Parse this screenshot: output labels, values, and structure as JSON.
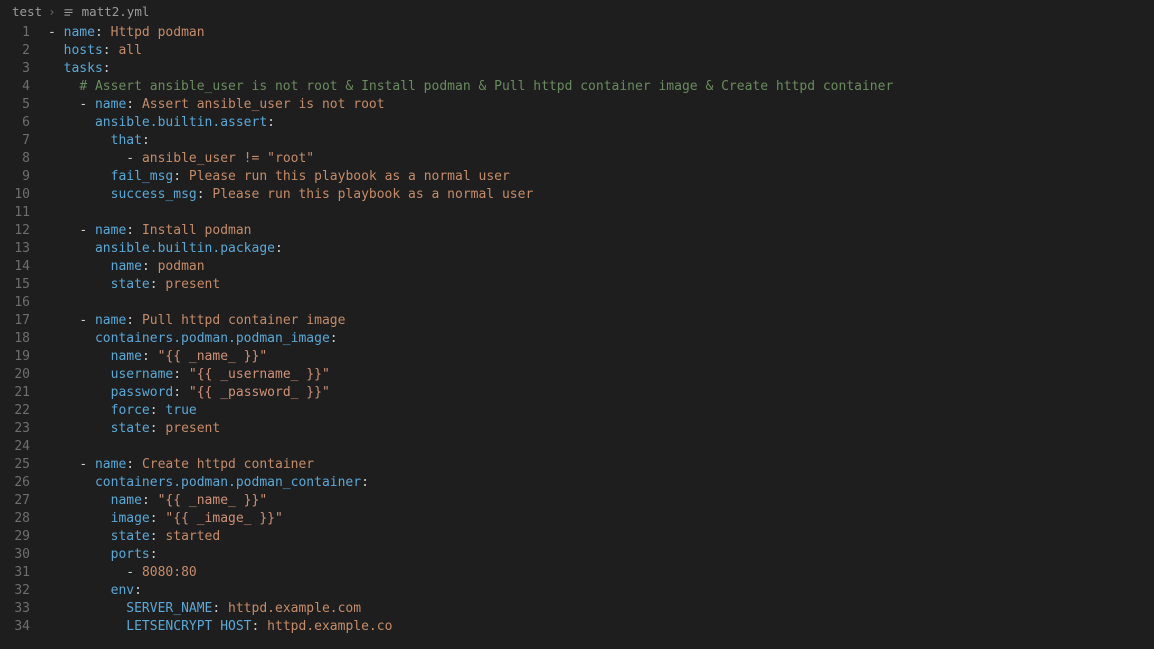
{
  "breadcrumb": {
    "folder": "test",
    "file": "matt2.yml"
  },
  "lines": [
    {
      "num": "1",
      "indent": 0,
      "guides": [],
      "tokens": [
        {
          "c": "tok-dash",
          "t": "- "
        },
        {
          "c": "tok-key",
          "t": "name"
        },
        {
          "c": "tok-colon",
          "t": ": "
        },
        {
          "c": "tok-plain",
          "t": "Httpd podman"
        }
      ]
    },
    {
      "num": "2",
      "indent": 1,
      "guides": [
        0
      ],
      "tokens": [
        {
          "c": "tok-key",
          "t": "hosts"
        },
        {
          "c": "tok-colon",
          "t": ": "
        },
        {
          "c": "tok-plain",
          "t": "all"
        }
      ]
    },
    {
      "num": "3",
      "indent": 1,
      "guides": [
        0
      ],
      "tokens": [
        {
          "c": "tok-key",
          "t": "tasks"
        },
        {
          "c": "tok-colon",
          "t": ":"
        }
      ]
    },
    {
      "num": "4",
      "indent": 2,
      "guides": [
        0,
        1
      ],
      "tokens": [
        {
          "c": "tok-comment",
          "t": "# Assert ansible_user is not root & Install podman & Pull httpd container image & Create httpd container"
        }
      ]
    },
    {
      "num": "5",
      "indent": 2,
      "guides": [
        0,
        1
      ],
      "tokens": [
        {
          "c": "tok-dash",
          "t": "- "
        },
        {
          "c": "tok-key",
          "t": "name"
        },
        {
          "c": "tok-colon",
          "t": ": "
        },
        {
          "c": "tok-plain",
          "t": "Assert ansible_user is not root"
        }
      ]
    },
    {
      "num": "6",
      "indent": 3,
      "guides": [
        0,
        1,
        2
      ],
      "tokens": [
        {
          "c": "tok-key",
          "t": "ansible.builtin.assert"
        },
        {
          "c": "tok-colon",
          "t": ":"
        }
      ]
    },
    {
      "num": "7",
      "indent": 4,
      "guides": [
        0,
        1,
        2,
        3
      ],
      "tokens": [
        {
          "c": "tok-key",
          "t": "that"
        },
        {
          "c": "tok-colon",
          "t": ":"
        }
      ]
    },
    {
      "num": "8",
      "indent": 5,
      "guides": [
        0,
        1,
        2,
        3,
        4
      ],
      "tokens": [
        {
          "c": "tok-dash",
          "t": "- "
        },
        {
          "c": "tok-plain",
          "t": "ansible_user != \"root\""
        }
      ]
    },
    {
      "num": "9",
      "indent": 4,
      "guides": [
        0,
        1,
        2,
        3
      ],
      "tokens": [
        {
          "c": "tok-key",
          "t": "fail_msg"
        },
        {
          "c": "tok-colon",
          "t": ": "
        },
        {
          "c": "tok-plain",
          "t": "Please run this playbook as a normal user"
        }
      ]
    },
    {
      "num": "10",
      "indent": 4,
      "guides": [
        0,
        1,
        2,
        3
      ],
      "tokens": [
        {
          "c": "tok-key",
          "t": "success_msg"
        },
        {
          "c": "tok-colon",
          "t": ": "
        },
        {
          "c": "tok-plain",
          "t": "Please run this playbook as a normal user"
        }
      ]
    },
    {
      "num": "11",
      "indent": 0,
      "guides": [],
      "tokens": []
    },
    {
      "num": "12",
      "indent": 2,
      "guides": [
        0,
        1
      ],
      "tokens": [
        {
          "c": "tok-dash",
          "t": "- "
        },
        {
          "c": "tok-key",
          "t": "name"
        },
        {
          "c": "tok-colon",
          "t": ": "
        },
        {
          "c": "tok-plain",
          "t": "Install podman"
        }
      ]
    },
    {
      "num": "13",
      "indent": 3,
      "guides": [
        0,
        1,
        2
      ],
      "tokens": [
        {
          "c": "tok-key",
          "t": "ansible.builtin.package"
        },
        {
          "c": "tok-colon",
          "t": ":"
        }
      ]
    },
    {
      "num": "14",
      "indent": 4,
      "guides": [
        0,
        1,
        2,
        3
      ],
      "tokens": [
        {
          "c": "tok-key",
          "t": "name"
        },
        {
          "c": "tok-colon",
          "t": ": "
        },
        {
          "c": "tok-plain",
          "t": "podman"
        }
      ]
    },
    {
      "num": "15",
      "indent": 4,
      "guides": [
        0,
        1,
        2,
        3
      ],
      "tokens": [
        {
          "c": "tok-key",
          "t": "state"
        },
        {
          "c": "tok-colon",
          "t": ": "
        },
        {
          "c": "tok-plain",
          "t": "present"
        }
      ]
    },
    {
      "num": "16",
      "indent": 0,
      "guides": [],
      "tokens": []
    },
    {
      "num": "17",
      "indent": 2,
      "guides": [
        0,
        1
      ],
      "tokens": [
        {
          "c": "tok-dash",
          "t": "- "
        },
        {
          "c": "tok-key",
          "t": "name"
        },
        {
          "c": "tok-colon",
          "t": ": "
        },
        {
          "c": "tok-plain",
          "t": "Pull httpd container image"
        }
      ]
    },
    {
      "num": "18",
      "indent": 3,
      "guides": [
        0,
        1,
        2
      ],
      "tokens": [
        {
          "c": "tok-key",
          "t": "containers.podman.podman_image"
        },
        {
          "c": "tok-colon",
          "t": ":"
        }
      ]
    },
    {
      "num": "19",
      "indent": 4,
      "guides": [
        0,
        1,
        2,
        3
      ],
      "tokens": [
        {
          "c": "tok-key",
          "t": "name"
        },
        {
          "c": "tok-colon",
          "t": ": "
        },
        {
          "c": "tok-str",
          "t": "\"{{ _name_ }}\""
        }
      ]
    },
    {
      "num": "20",
      "indent": 4,
      "guides": [
        0,
        1,
        2,
        3
      ],
      "tokens": [
        {
          "c": "tok-key",
          "t": "username"
        },
        {
          "c": "tok-colon",
          "t": ": "
        },
        {
          "c": "tok-str",
          "t": "\"{{ _username_ }}\""
        }
      ]
    },
    {
      "num": "21",
      "indent": 4,
      "guides": [
        0,
        1,
        2,
        3
      ],
      "tokens": [
        {
          "c": "tok-key",
          "t": "password"
        },
        {
          "c": "tok-colon",
          "t": ": "
        },
        {
          "c": "tok-str",
          "t": "\"{{ _password_ }}\""
        }
      ]
    },
    {
      "num": "22",
      "indent": 4,
      "guides": [
        0,
        1,
        2,
        3
      ],
      "tokens": [
        {
          "c": "tok-key",
          "t": "force"
        },
        {
          "c": "tok-colon",
          "t": ": "
        },
        {
          "c": "tok-bool",
          "t": "true"
        }
      ]
    },
    {
      "num": "23",
      "indent": 4,
      "guides": [
        0,
        1,
        2,
        3
      ],
      "tokens": [
        {
          "c": "tok-key",
          "t": "state"
        },
        {
          "c": "tok-colon",
          "t": ": "
        },
        {
          "c": "tok-plain",
          "t": "present"
        }
      ]
    },
    {
      "num": "24",
      "indent": 0,
      "guides": [],
      "tokens": []
    },
    {
      "num": "25",
      "indent": 2,
      "guides": [
        0,
        1
      ],
      "tokens": [
        {
          "c": "tok-dash",
          "t": "- "
        },
        {
          "c": "tok-key",
          "t": "name"
        },
        {
          "c": "tok-colon",
          "t": ": "
        },
        {
          "c": "tok-plain",
          "t": "Create httpd container"
        }
      ]
    },
    {
      "num": "26",
      "indent": 3,
      "guides": [
        0,
        1,
        2
      ],
      "tokens": [
        {
          "c": "tok-key",
          "t": "containers.podman.podman_container"
        },
        {
          "c": "tok-colon",
          "t": ":"
        }
      ]
    },
    {
      "num": "27",
      "indent": 4,
      "guides": [
        0,
        1,
        2,
        3
      ],
      "tokens": [
        {
          "c": "tok-key",
          "t": "name"
        },
        {
          "c": "tok-colon",
          "t": ": "
        },
        {
          "c": "tok-str",
          "t": "\"{{ _name_ }}\""
        }
      ]
    },
    {
      "num": "28",
      "indent": 4,
      "guides": [
        0,
        1,
        2,
        3
      ],
      "tokens": [
        {
          "c": "tok-key",
          "t": "image"
        },
        {
          "c": "tok-colon",
          "t": ": "
        },
        {
          "c": "tok-str",
          "t": "\"{{ _image_ }}\""
        }
      ]
    },
    {
      "num": "29",
      "indent": 4,
      "guides": [
        0,
        1,
        2,
        3
      ],
      "tokens": [
        {
          "c": "tok-key",
          "t": "state"
        },
        {
          "c": "tok-colon",
          "t": ": "
        },
        {
          "c": "tok-plain",
          "t": "started"
        }
      ]
    },
    {
      "num": "30",
      "indent": 4,
      "guides": [
        0,
        1,
        2,
        3
      ],
      "tokens": [
        {
          "c": "tok-key",
          "t": "ports"
        },
        {
          "c": "tok-colon",
          "t": ":"
        }
      ]
    },
    {
      "num": "31",
      "indent": 5,
      "guides": [
        0,
        1,
        2,
        3,
        4
      ],
      "tokens": [
        {
          "c": "tok-dash",
          "t": "- "
        },
        {
          "c": "tok-plain",
          "t": "8080:80"
        }
      ]
    },
    {
      "num": "32",
      "indent": 4,
      "guides": [
        0,
        1,
        2,
        3
      ],
      "tokens": [
        {
          "c": "tok-key",
          "t": "env"
        },
        {
          "c": "tok-colon",
          "t": ":"
        }
      ]
    },
    {
      "num": "33",
      "indent": 5,
      "guides": [
        0,
        1,
        2,
        3,
        4
      ],
      "tokens": [
        {
          "c": "tok-key",
          "t": "SERVER_NAME"
        },
        {
          "c": "tok-colon",
          "t": ": "
        },
        {
          "c": "tok-plain",
          "t": "httpd.example.com"
        }
      ]
    },
    {
      "num": "34",
      "indent": 5,
      "guides": [
        0,
        1,
        2,
        3,
        4
      ],
      "tokens": [
        {
          "c": "tok-key",
          "t": "LETSENCRYPT HOST"
        },
        {
          "c": "tok-colon",
          "t": ": "
        },
        {
          "c": "tok-plain",
          "t": "httpd.example.co"
        }
      ]
    }
  ]
}
